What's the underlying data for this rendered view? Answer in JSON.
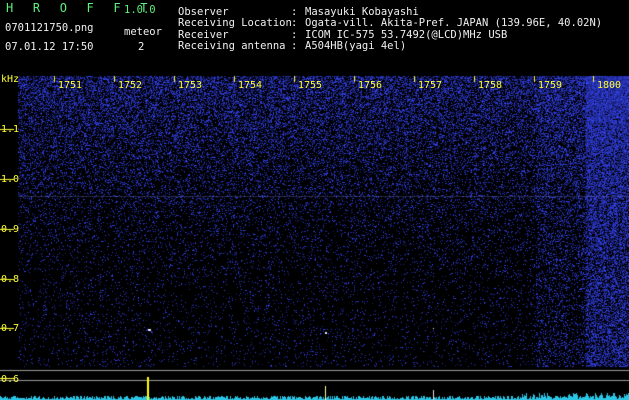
{
  "app": {
    "title": "H R O F F T",
    "version": "1.0.0"
  },
  "file": {
    "name": "0701121750.png",
    "datetime": "07.01.12 17:50"
  },
  "meteor": {
    "label": "meteor",
    "count": "2"
  },
  "info": [
    {
      "key": "Observer",
      "sep": ":",
      "value": "Masayuki Kobayashi"
    },
    {
      "key": "Receiving Location",
      "sep": ":",
      "value": "Ogata-vill. Akita-Pref. JAPAN (139.96E, 40.02N)"
    },
    {
      "key": "Receiver",
      "sep": ":",
      "value": "ICOM IC-575 53.7492(@LCD)MHz USB"
    },
    {
      "key": "Receiving antenna",
      "sep": ":",
      "value": "A504HB(yagi 4el)"
    }
  ],
  "axis": {
    "unit": "kHz",
    "y_labels": [
      "1.1",
      "1.0",
      "0.9",
      "0.8",
      "0.7",
      "0.6"
    ],
    "time_labels": [
      "1751",
      "1752",
      "1753",
      "1754",
      "1755",
      "1756",
      "1757",
      "1758",
      "1759",
      "1800"
    ]
  },
  "colors": {
    "background": "#000000",
    "title": "#5df07a",
    "labels": "#ffff33",
    "text": "#f0f0f0",
    "spectrum": "#3a46ff",
    "meteor_echo": "#ffff00"
  }
}
